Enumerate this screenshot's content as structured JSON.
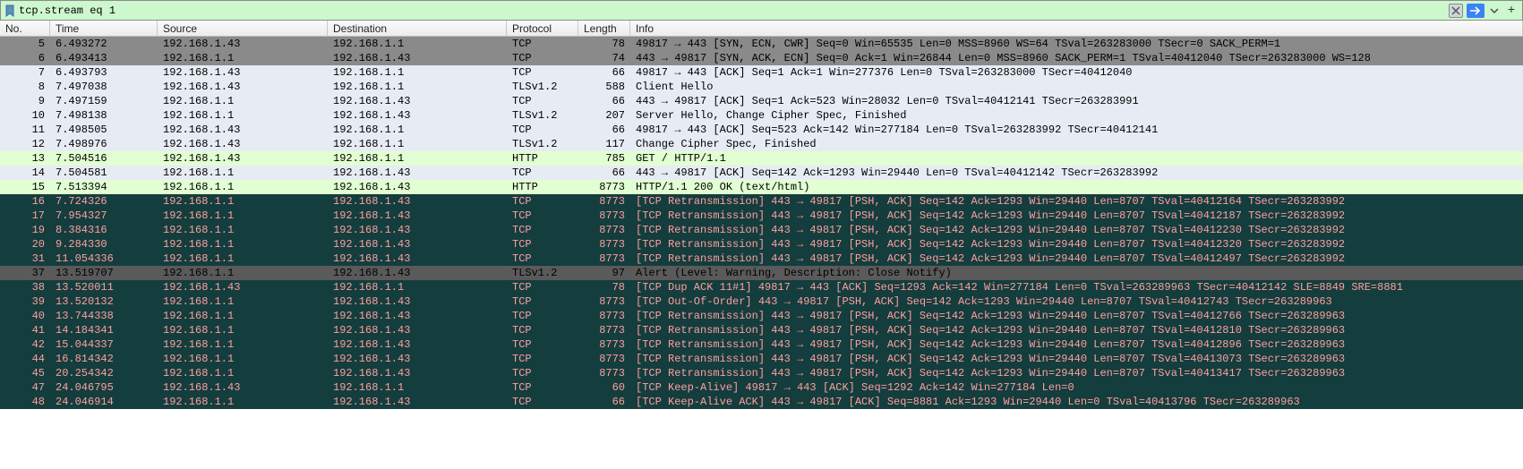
{
  "filter": {
    "value": "tcp.stream eq 1"
  },
  "columns": {
    "no": "No.",
    "time": "Time",
    "source": "Source",
    "destination": "Destination",
    "protocol": "Protocol",
    "length": "Length",
    "info": "Info"
  },
  "rows": [
    {
      "cls": "c-selected-gray",
      "no": "5",
      "time": "6.493272",
      "src": "192.168.1.43",
      "dst": "192.168.1.1",
      "proto": "TCP",
      "len": "78",
      "info": "49817 → 443 [SYN, ECN, CWR] Seq=0 Win=65535 Len=0 MSS=8960 WS=64 TSval=263283000 TSecr=0 SACK_PERM=1"
    },
    {
      "cls": "c-selected-gray",
      "no": "6",
      "time": "6.493413",
      "src": "192.168.1.1",
      "dst": "192.168.1.43",
      "proto": "TCP",
      "len": "74",
      "info": "443 → 49817 [SYN, ACK, ECN] Seq=0 Ack=1 Win=26844 Len=0 MSS=8960 SACK_PERM=1 TSval=40412040 TSecr=263283000 WS=128"
    },
    {
      "cls": "c-light",
      "no": "7",
      "time": "6.493793",
      "src": "192.168.1.43",
      "dst": "192.168.1.1",
      "proto": "TCP",
      "len": "66",
      "info": "49817 → 443 [ACK] Seq=1 Ack=1 Win=277376 Len=0 TSval=263283000 TSecr=40412040"
    },
    {
      "cls": "c-light",
      "no": "8",
      "time": "7.497038",
      "src": "192.168.1.43",
      "dst": "192.168.1.1",
      "proto": "TLSv1.2",
      "len": "588",
      "info": "Client Hello"
    },
    {
      "cls": "c-light",
      "no": "9",
      "time": "7.497159",
      "src": "192.168.1.1",
      "dst": "192.168.1.43",
      "proto": "TCP",
      "len": "66",
      "info": "443 → 49817 [ACK] Seq=1 Ack=523 Win=28032 Len=0 TSval=40412141 TSecr=263283991"
    },
    {
      "cls": "c-light",
      "no": "10",
      "time": "7.498138",
      "src": "192.168.1.1",
      "dst": "192.168.1.43",
      "proto": "TLSv1.2",
      "len": "207",
      "info": "Server Hello, Change Cipher Spec, Finished"
    },
    {
      "cls": "c-light",
      "no": "11",
      "time": "7.498505",
      "src": "192.168.1.43",
      "dst": "192.168.1.1",
      "proto": "TCP",
      "len": "66",
      "info": "49817 → 443 [ACK] Seq=523 Ack=142 Win=277184 Len=0 TSval=263283992 TSecr=40412141"
    },
    {
      "cls": "c-light",
      "no": "12",
      "time": "7.498976",
      "src": "192.168.1.43",
      "dst": "192.168.1.1",
      "proto": "TLSv1.2",
      "len": "117",
      "info": "Change Cipher Spec, Finished"
    },
    {
      "cls": "c-light-green",
      "no": "13",
      "time": "7.504516",
      "src": "192.168.1.43",
      "dst": "192.168.1.1",
      "proto": "HTTP",
      "len": "785",
      "info": "GET / HTTP/1.1"
    },
    {
      "cls": "c-light",
      "no": "14",
      "time": "7.504581",
      "src": "192.168.1.1",
      "dst": "192.168.1.43",
      "proto": "TCP",
      "len": "66",
      "info": "443 → 49817 [ACK] Seq=142 Ack=1293 Win=29440 Len=0 TSval=40412142 TSecr=263283992"
    },
    {
      "cls": "c-light-green",
      "no": "15",
      "time": "7.513394",
      "src": "192.168.1.1",
      "dst": "192.168.1.43",
      "proto": "HTTP",
      "len": "8773",
      "info": "HTTP/1.1 200 OK  (text/html)"
    },
    {
      "cls": "c-dark-teal",
      "no": "16",
      "time": "7.724326",
      "src": "192.168.1.1",
      "dst": "192.168.1.43",
      "proto": "TCP",
      "len": "8773",
      "info": "[TCP Retransmission] 443 → 49817 [PSH, ACK] Seq=142 Ack=1293 Win=29440 Len=8707 TSval=40412164 TSecr=263283992"
    },
    {
      "cls": "c-dark-teal",
      "no": "17",
      "time": "7.954327",
      "src": "192.168.1.1",
      "dst": "192.168.1.43",
      "proto": "TCP",
      "len": "8773",
      "info": "[TCP Retransmission] 443 → 49817 [PSH, ACK] Seq=142 Ack=1293 Win=29440 Len=8707 TSval=40412187 TSecr=263283992"
    },
    {
      "cls": "c-dark-teal",
      "no": "19",
      "time": "8.384316",
      "src": "192.168.1.1",
      "dst": "192.168.1.43",
      "proto": "TCP",
      "len": "8773",
      "info": "[TCP Retransmission] 443 → 49817 [PSH, ACK] Seq=142 Ack=1293 Win=29440 Len=8707 TSval=40412230 TSecr=263283992"
    },
    {
      "cls": "c-dark-teal",
      "no": "20",
      "time": "9.284330",
      "src": "192.168.1.1",
      "dst": "192.168.1.43",
      "proto": "TCP",
      "len": "8773",
      "info": "[TCP Retransmission] 443 → 49817 [PSH, ACK] Seq=142 Ack=1293 Win=29440 Len=8707 TSval=40412320 TSecr=263283992"
    },
    {
      "cls": "c-dark-teal",
      "no": "31",
      "time": "11.054336",
      "src": "192.168.1.1",
      "dst": "192.168.1.43",
      "proto": "TCP",
      "len": "8773",
      "info": "[TCP Retransmission] 443 → 49817 [PSH, ACK] Seq=142 Ack=1293 Win=29440 Len=8707 TSval=40412497 TSecr=263283992"
    },
    {
      "cls": "c-selected-dark",
      "no": "37",
      "time": "13.519707",
      "src": "192.168.1.1",
      "dst": "192.168.1.43",
      "proto": "TLSv1.2",
      "len": "97",
      "info": "Alert (Level: Warning, Description: Close Notify)"
    },
    {
      "cls": "c-dark-teal",
      "no": "38",
      "time": "13.520011",
      "src": "192.168.1.43",
      "dst": "192.168.1.1",
      "proto": "TCP",
      "len": "78",
      "info": "[TCP Dup ACK 11#1] 49817 → 443 [ACK] Seq=1293 Ack=142 Win=277184 Len=0 TSval=263289963 TSecr=40412142 SLE=8849 SRE=8881"
    },
    {
      "cls": "c-dark-teal",
      "no": "39",
      "time": "13.520132",
      "src": "192.168.1.1",
      "dst": "192.168.1.43",
      "proto": "TCP",
      "len": "8773",
      "info": "[TCP Out-Of-Order] 443 → 49817 [PSH, ACK] Seq=142 Ack=1293 Win=29440 Len=8707 TSval=40412743 TSecr=263289963"
    },
    {
      "cls": "c-dark-teal",
      "no": "40",
      "time": "13.744338",
      "src": "192.168.1.1",
      "dst": "192.168.1.43",
      "proto": "TCP",
      "len": "8773",
      "info": "[TCP Retransmission] 443 → 49817 [PSH, ACK] Seq=142 Ack=1293 Win=29440 Len=8707 TSval=40412766 TSecr=263289963"
    },
    {
      "cls": "c-dark-teal",
      "no": "41",
      "time": "14.184341",
      "src": "192.168.1.1",
      "dst": "192.168.1.43",
      "proto": "TCP",
      "len": "8773",
      "info": "[TCP Retransmission] 443 → 49817 [PSH, ACK] Seq=142 Ack=1293 Win=29440 Len=8707 TSval=40412810 TSecr=263289963"
    },
    {
      "cls": "c-dark-teal",
      "no": "42",
      "time": "15.044337",
      "src": "192.168.1.1",
      "dst": "192.168.1.43",
      "proto": "TCP",
      "len": "8773",
      "info": "[TCP Retransmission] 443 → 49817 [PSH, ACK] Seq=142 Ack=1293 Win=29440 Len=8707 TSval=40412896 TSecr=263289963"
    },
    {
      "cls": "c-dark-teal",
      "no": "44",
      "time": "16.814342",
      "src": "192.168.1.1",
      "dst": "192.168.1.43",
      "proto": "TCP",
      "len": "8773",
      "info": "[TCP Retransmission] 443 → 49817 [PSH, ACK] Seq=142 Ack=1293 Win=29440 Len=8707 TSval=40413073 TSecr=263289963"
    },
    {
      "cls": "c-dark-teal",
      "no": "45",
      "time": "20.254342",
      "src": "192.168.1.1",
      "dst": "192.168.1.43",
      "proto": "TCP",
      "len": "8773",
      "info": "[TCP Retransmission] 443 → 49817 [PSH, ACK] Seq=142 Ack=1293 Win=29440 Len=8707 TSval=40413417 TSecr=263289963"
    },
    {
      "cls": "c-dark-teal",
      "no": "47",
      "time": "24.046795",
      "src": "192.168.1.43",
      "dst": "192.168.1.1",
      "proto": "TCP",
      "len": "60",
      "info": "[TCP Keep-Alive] 49817 → 443 [ACK] Seq=1292 Ack=142 Win=277184 Len=0"
    },
    {
      "cls": "c-dark-teal",
      "no": "48",
      "time": "24.046914",
      "src": "192.168.1.1",
      "dst": "192.168.1.43",
      "proto": "TCP",
      "len": "66",
      "info": "[TCP Keep-Alive ACK] 443 → 49817 [ACK] Seq=8881 Ack=1293 Win=29440 Len=0 TSval=40413796 TSecr=263289963"
    }
  ]
}
